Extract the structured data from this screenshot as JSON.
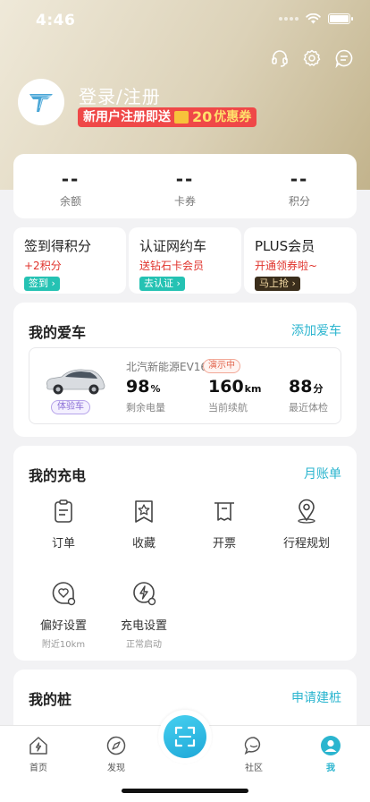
{
  "status": {
    "time": "4:46"
  },
  "profile": {
    "login": "登录/注册",
    "promo_prefix": "新用户注册即送",
    "promo_amount": "20",
    "promo_suffix": "优惠券"
  },
  "balance": [
    {
      "value": "--",
      "label": "余额"
    },
    {
      "value": "--",
      "label": "卡券"
    },
    {
      "value": "--",
      "label": "积分"
    }
  ],
  "quick": [
    {
      "title": "签到得积分",
      "sub": "+2积分",
      "button": "签到",
      "color": "#25c2b3"
    },
    {
      "title": "认证网约车",
      "sub": "送钻石卡会员",
      "button": "去认证",
      "color": "#25c2b3"
    },
    {
      "title": "PLUS会员",
      "sub": "开通领券啦~",
      "button": "马上抢",
      "color": "#3b2e1c"
    }
  ],
  "my_car": {
    "title": "我的爱车",
    "link": "添加爱车",
    "trial_badge": "体验车",
    "name": "北汽新能源EV160",
    "demo_badge": "演示中",
    "stats": [
      {
        "value": "98",
        "unit": "%",
        "label": "剩余电量"
      },
      {
        "value": "160",
        "unit": "km",
        "label": "当前续航"
      },
      {
        "value": "88",
        "unit": "分",
        "label": "最近体检"
      }
    ]
  },
  "my_charge": {
    "title": "我的充电",
    "link": "月账单",
    "items": [
      {
        "label": "订单",
        "sub": ""
      },
      {
        "label": "收藏",
        "sub": ""
      },
      {
        "label": "开票",
        "sub": ""
      },
      {
        "label": "行程规划",
        "sub": ""
      },
      {
        "label": "偏好设置",
        "sub": "附近10km"
      },
      {
        "label": "充电设置",
        "sub": "正常启动"
      }
    ]
  },
  "my_pile": {
    "title": "我的桩",
    "link": "申请建桩"
  },
  "tabs": [
    {
      "label": "首页"
    },
    {
      "label": "发现"
    },
    {
      "label": "社区"
    },
    {
      "label": "我"
    }
  ],
  "colors": {
    "accent": "#2bb5cf",
    "promo_red": "#ef4848",
    "price_red": "#e0322b"
  }
}
